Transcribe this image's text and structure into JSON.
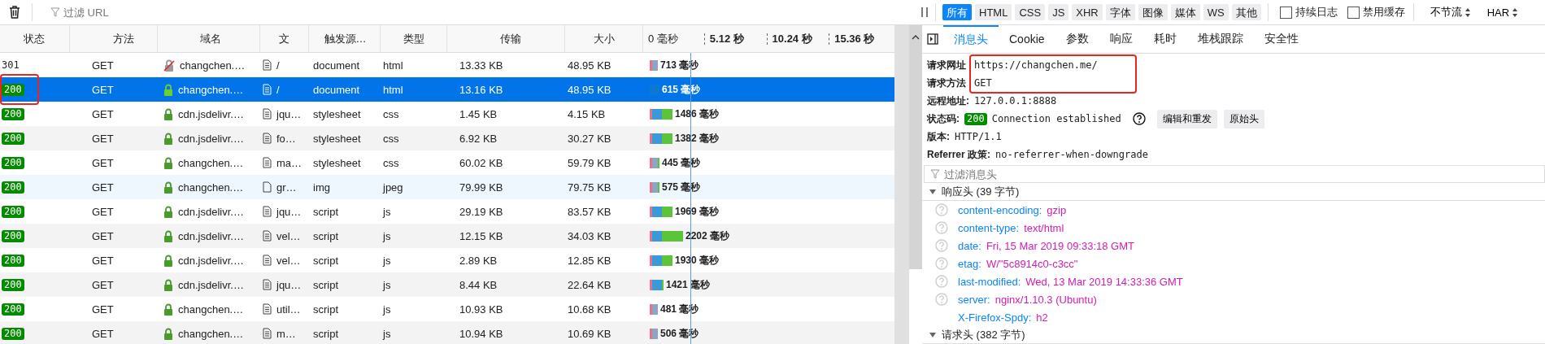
{
  "toolbar": {
    "filter": {
      "placeholder": "过滤 URL"
    },
    "type_filters": [
      {
        "label": "所有",
        "selected": true
      },
      {
        "label": "HTML",
        "selected": false
      },
      {
        "label": "CSS",
        "selected": false
      },
      {
        "label": "JS",
        "selected": false
      },
      {
        "label": "XHR",
        "selected": false
      },
      {
        "label": "字体",
        "selected": false
      },
      {
        "label": "图像",
        "selected": false
      },
      {
        "label": "媒体",
        "selected": false
      },
      {
        "label": "WS",
        "selected": false
      },
      {
        "label": "其他",
        "selected": false
      }
    ],
    "checkboxes": [
      {
        "label": "持续日志",
        "checked": false
      },
      {
        "label": "禁用缓存",
        "checked": false
      }
    ],
    "throttle": "不节流",
    "export": "HAR"
  },
  "table": {
    "columns": [
      "状态",
      "方法",
      "域名",
      "文",
      "触发源…",
      "类型",
      "传输",
      "大小"
    ],
    "waterfall_ticks": [
      "0 毫秒",
      "5.12 秒",
      "10.24 秒",
      "15.36 秒"
    ],
    "rows": [
      {
        "status": "301",
        "badge": false,
        "method": "GET",
        "domain": "changchen.…",
        "secure": false,
        "file": {
          "kind": "text",
          "label": "/"
        },
        "trigger": "document",
        "type": "html",
        "transfer": "13.33 KB",
        "size": "48.95 KB",
        "timing": "713 毫秒",
        "segments": [
          {
            "kind": "blocked"
          },
          {
            "kind": "connect"
          }
        ],
        "selected": false,
        "hovered": false,
        "annotated": false
      },
      {
        "status": "200",
        "badge": true,
        "method": "GET",
        "domain": "changchen.…",
        "secure": true,
        "file": {
          "kind": "text",
          "label": "/"
        },
        "trigger": "document",
        "type": "html",
        "transfer": "13.16 KB",
        "size": "48.95 KB",
        "timing": "615 毫秒",
        "segments": [
          {
            "kind": "wait"
          }
        ],
        "selected": true,
        "hovered": false,
        "annotated": true
      },
      {
        "status": "200",
        "badge": true,
        "method": "GET",
        "domain": "cdn.jsdelivr.…",
        "secure": true,
        "file": {
          "kind": "text",
          "label": "jqu…"
        },
        "trigger": "stylesheet",
        "type": "css",
        "transfer": "1.45 KB",
        "size": "4.15 KB",
        "timing": "1486 毫秒",
        "segments": [
          {
            "kind": "blocked"
          },
          {
            "kind": "wait"
          },
          {
            "kind": "receive"
          }
        ],
        "selected": false,
        "hovered": false,
        "annotated": false
      },
      {
        "status": "200",
        "badge": true,
        "method": "GET",
        "domain": "cdn.jsdelivr.…",
        "secure": true,
        "file": {
          "kind": "text",
          "label": "fo…"
        },
        "trigger": "stylesheet",
        "type": "css",
        "transfer": "6.92 KB",
        "size": "30.27 KB",
        "timing": "1382 毫秒",
        "segments": [
          {
            "kind": "blocked"
          },
          {
            "kind": "wait"
          },
          {
            "kind": "receive"
          }
        ],
        "selected": false,
        "hovered": false,
        "annotated": false
      },
      {
        "status": "200",
        "badge": true,
        "method": "GET",
        "domain": "changchen.…",
        "secure": true,
        "file": {
          "kind": "text",
          "label": "ma…"
        },
        "trigger": "stylesheet",
        "type": "css",
        "transfer": "60.02 KB",
        "size": "59.79 KB",
        "timing": "445 毫秒",
        "segments": [
          {
            "kind": "blocked"
          },
          {
            "kind": "connect"
          },
          {
            "kind": "tail"
          }
        ],
        "selected": false,
        "hovered": false,
        "annotated": false
      },
      {
        "status": "200",
        "badge": true,
        "method": "GET",
        "domain": "changchen.…",
        "secure": true,
        "file": {
          "kind": "image",
          "label": "gr…"
        },
        "trigger": "img",
        "type": "jpeg",
        "transfer": "79.99 KB",
        "size": "79.75 KB",
        "timing": "575 毫秒",
        "segments": [
          {
            "kind": "blocked"
          },
          {
            "kind": "connect"
          },
          {
            "kind": "tail"
          }
        ],
        "selected": false,
        "hovered": true,
        "annotated": false
      },
      {
        "status": "200",
        "badge": true,
        "method": "GET",
        "domain": "cdn.jsdelivr.…",
        "secure": true,
        "file": {
          "kind": "text",
          "label": "jqu…"
        },
        "trigger": "script",
        "type": "js",
        "transfer": "29.19 KB",
        "size": "83.57 KB",
        "timing": "1969 毫秒",
        "segments": [
          {
            "kind": "blocked"
          },
          {
            "kind": "wait"
          },
          {
            "kind": "receive"
          }
        ],
        "selected": false,
        "hovered": false,
        "annotated": false
      },
      {
        "status": "200",
        "badge": true,
        "method": "GET",
        "domain": "cdn.jsdelivr.…",
        "secure": true,
        "file": {
          "kind": "text",
          "label": "vel…"
        },
        "trigger": "script",
        "type": "js",
        "transfer": "12.15 KB",
        "size": "34.03 KB",
        "timing": "2202 毫秒",
        "segments": [
          {
            "kind": "blocked"
          },
          {
            "kind": "wait"
          },
          {
            "kind": "receive"
          },
          {
            "kind": "receive"
          }
        ],
        "selected": false,
        "hovered": false,
        "annotated": false
      },
      {
        "status": "200",
        "badge": true,
        "method": "GET",
        "domain": "cdn.jsdelivr.…",
        "secure": true,
        "file": {
          "kind": "text",
          "label": "vel…"
        },
        "trigger": "script",
        "type": "js",
        "transfer": "2.89 KB",
        "size": "12.85 KB",
        "timing": "1930 毫秒",
        "segments": [
          {
            "kind": "blocked"
          },
          {
            "kind": "wait"
          },
          {
            "kind": "receive"
          }
        ],
        "selected": false,
        "hovered": false,
        "annotated": false
      },
      {
        "status": "200",
        "badge": true,
        "method": "GET",
        "domain": "cdn.jsdelivr.…",
        "secure": true,
        "file": {
          "kind": "text",
          "label": "jqu…"
        },
        "trigger": "script",
        "type": "js",
        "transfer": "8.44 KB",
        "size": "22.64 KB",
        "timing": "1421 毫秒",
        "segments": [
          {
            "kind": "blocked"
          },
          {
            "kind": "wait"
          },
          {
            "kind": "tail"
          }
        ],
        "selected": false,
        "hovered": false,
        "annotated": false
      },
      {
        "status": "200",
        "badge": true,
        "method": "GET",
        "domain": "changchen.…",
        "secure": true,
        "file": {
          "kind": "text",
          "label": "util…"
        },
        "trigger": "script",
        "type": "js",
        "transfer": "10.93 KB",
        "size": "10.68 KB",
        "timing": "481 毫秒",
        "segments": [
          {
            "kind": "blocked"
          },
          {
            "kind": "connect"
          }
        ],
        "selected": false,
        "hovered": false,
        "annotated": false
      },
      {
        "status": "200",
        "badge": true,
        "method": "GET",
        "domain": "changchen.…",
        "secure": true,
        "file": {
          "kind": "text",
          "label": "m…"
        },
        "trigger": "script",
        "type": "js",
        "transfer": "10.94 KB",
        "size": "10.69 KB",
        "timing": "506 毫秒",
        "segments": [
          {
            "kind": "blocked"
          },
          {
            "kind": "connect"
          }
        ],
        "selected": false,
        "hovered": false,
        "annotated": false
      }
    ]
  },
  "details": {
    "tabs": [
      {
        "label": "消息头",
        "selected": true
      },
      {
        "label": "Cookie",
        "selected": false
      },
      {
        "label": "参数",
        "selected": false
      },
      {
        "label": "响应",
        "selected": false
      },
      {
        "label": "耗时",
        "selected": false
      },
      {
        "label": "堆栈跟踪",
        "selected": false
      },
      {
        "label": "安全性",
        "selected": false
      }
    ],
    "summary": [
      {
        "kind": "plain",
        "label": "请求网址",
        "value": "https://changchen.me/",
        "annotated": true
      },
      {
        "kind": "plain",
        "label": "请求方法",
        "value": "GET",
        "annotated": true
      },
      {
        "kind": "plain",
        "label": "远程地址:",
        "value": "127.0.0.1:8888",
        "annotated": false
      },
      {
        "kind": "status",
        "label": "状态码:",
        "badge": "200",
        "value": "Connection established",
        "buttons": [
          "编辑和重发",
          "原始头"
        ],
        "annotated": false
      },
      {
        "kind": "plain",
        "label": "版本:",
        "value": "HTTP/1.1",
        "annotated": false
      },
      {
        "kind": "plain",
        "label": "Referrer 政策:",
        "value": "no-referrer-when-downgrade",
        "annotated": false
      }
    ],
    "filter": {
      "placeholder": "过滤消息头"
    },
    "sections": [
      {
        "title": "响应头 (39 字节)",
        "expanded": true,
        "headers": [
          {
            "name": "content-encoding:",
            "value": "gzip",
            "help": true
          },
          {
            "name": "content-type:",
            "value": "text/html",
            "help": true
          },
          {
            "name": "date:",
            "value": "Fri, 15 Mar 2019 09:33:18 GMT",
            "help": true
          },
          {
            "name": "etag:",
            "value": "W/\"5c8914c0-c3cc\"",
            "help": true
          },
          {
            "name": "last-modified:",
            "value": "Wed, 13 Mar 2019 14:33:36 GMT",
            "help": true
          },
          {
            "name": "server:",
            "value": "nginx/1.10.3 (Ubuntu)",
            "help": true
          },
          {
            "name": "X-Firefox-Spdy:",
            "value": "h2",
            "help": false
          }
        ]
      },
      {
        "title": "请求头 (382 字节)",
        "expanded": true
      }
    ]
  }
}
